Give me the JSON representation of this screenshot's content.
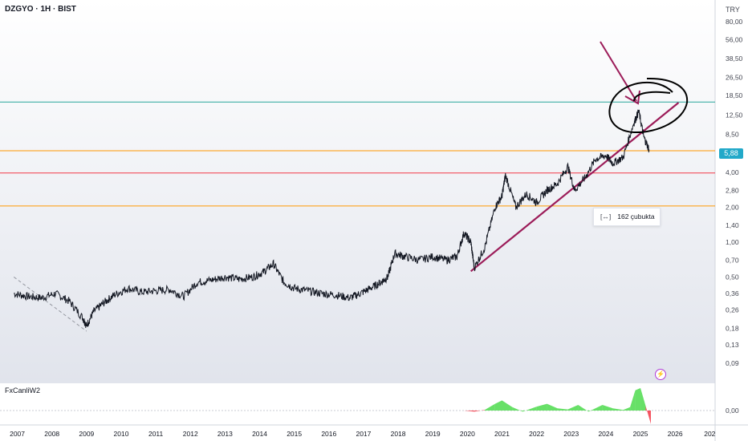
{
  "header": {
    "symbol_title": "DZGYO · 1H · BIST",
    "currency": "TRY"
  },
  "price_badge": "5,88",
  "tooltip": {
    "icon": "bars-range-icon",
    "icon_glyph": "[↔]",
    "text": "162 çubukta"
  },
  "indicator": {
    "name": "FxCanliW2",
    "zero_label": "0,00",
    "alert_icon": "lightning-icon",
    "alert_glyph": "⚡"
  },
  "colors": {
    "line_teal": "#26a69a",
    "line_orange": "#ff9800",
    "line_red": "#f23645",
    "trendline": "#9c1c59",
    "annotation": "#9c1c59",
    "ellipse": "#000000",
    "badge": "#22a9c9",
    "osc_pos": "#4cda4c",
    "osc_neg": "#f23645"
  },
  "chart_data": {
    "type": "line",
    "xlabel": "",
    "ylabel": "",
    "y_scale": "log",
    "y_ticks": [
      "80,00",
      "56,00",
      "38,50",
      "26,50",
      "18,50",
      "12,50",
      "8,50",
      "5,88",
      "4,00",
      "2,80",
      "2,00",
      "1,40",
      "1,00",
      "0,70",
      "0,50",
      "0,36",
      "0,26",
      "0,18",
      "0,13",
      "0,09"
    ],
    "x_ticks": [
      "2007",
      "2008",
      "2009",
      "2010",
      "2011",
      "2012",
      "2013",
      "2014",
      "2015",
      "2016",
      "2017",
      "2018",
      "2019",
      "2020",
      "2021",
      "2022",
      "2023",
      "2024",
      "2025",
      "2026",
      "202"
    ],
    "series": [
      {
        "values_x": [
          2006.9,
          2007.3,
          2007.7,
          2008.1,
          2008.5,
          2008.9,
          2009.0,
          2009.2,
          2009.5,
          2009.8,
          2010.2,
          2010.6,
          2011.0,
          2011.4,
          2011.8,
          2012.2,
          2012.6,
          2013.0,
          2013.4,
          2013.8,
          2014.1,
          2014.4,
          2014.7,
          2015.0,
          2015.4,
          2015.8,
          2016.2,
          2016.6,
          2016.9,
          2017.2,
          2017.5,
          2017.7,
          2017.9,
          2018.2,
          2018.6,
          2019.0,
          2019.4,
          2019.7,
          2019.9,
          2020.1,
          2020.2,
          2020.5,
          2020.8,
          2021.0,
          2021.1,
          2021.4,
          2021.7,
          2022.0,
          2022.3,
          2022.6,
          2022.9,
          2023.1,
          2023.4,
          2023.7,
          2024.0,
          2024.2,
          2024.5,
          2024.8,
          2024.95,
          2025.1,
          2025.25
        ],
        "values": [
          0.36,
          0.34,
          0.33,
          0.36,
          0.31,
          0.22,
          0.19,
          0.25,
          0.3,
          0.35,
          0.4,
          0.37,
          0.38,
          0.39,
          0.34,
          0.45,
          0.47,
          0.5,
          0.48,
          0.5,
          0.55,
          0.65,
          0.45,
          0.4,
          0.38,
          0.36,
          0.35,
          0.33,
          0.36,
          0.4,
          0.45,
          0.5,
          0.8,
          0.75,
          0.7,
          0.75,
          0.7,
          0.75,
          1.2,
          1.0,
          0.6,
          0.9,
          2.0,
          2.5,
          3.8,
          2.0,
          2.6,
          2.2,
          2.8,
          3.2,
          4.5,
          2.8,
          3.6,
          5.2,
          5.6,
          4.8,
          5.4,
          10.5,
          13.5,
          8.0,
          6.3
        ]
      }
    ],
    "horizontal_levels": [
      {
        "value": 16.2,
        "color": "teal"
      },
      {
        "value": 6.15,
        "color": "orange"
      },
      {
        "value": 3.95,
        "color": "red"
      },
      {
        "value": 2.05,
        "color": "orange"
      }
    ],
    "trendline": {
      "from": [
        2020.1,
        0.56
      ],
      "to": [
        2026.1,
        16.0
      ]
    },
    "dashed_line": {
      "from": [
        2006.9,
        0.5
      ],
      "to": [
        2009.0,
        0.17
      ]
    },
    "oscillator": {
      "values_x": [
        2006.9,
        2019.9,
        2020.2,
        2020.5,
        2020.8,
        2021.0,
        2021.3,
        2021.6,
        2022.0,
        2022.3,
        2022.6,
        2022.9,
        2023.2,
        2023.5,
        2023.9,
        2024.2,
        2024.5,
        2024.7,
        2024.85,
        2025.0,
        2025.15,
        2025.3
      ],
      "values": [
        0,
        0,
        -0.1,
        0.05,
        0.6,
        0.9,
        0.3,
        -0.1,
        0.35,
        0.6,
        0.2,
        0.1,
        0.5,
        -0.1,
        0.5,
        0.2,
        0.05,
        0.3,
        1.8,
        2.0,
        0.4,
        -1.2
      ]
    }
  }
}
